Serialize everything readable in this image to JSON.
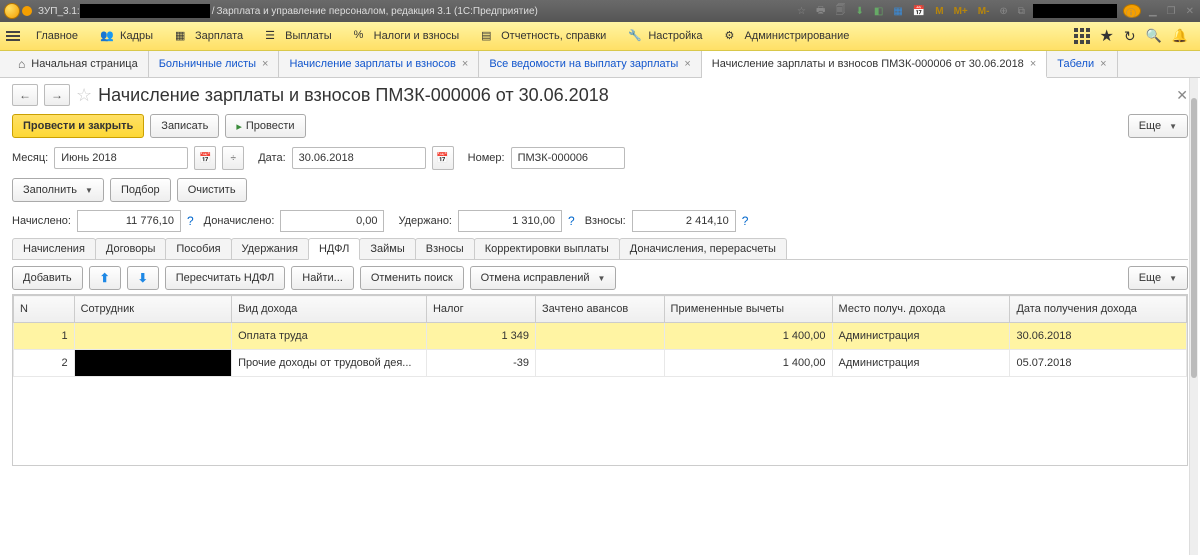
{
  "title": {
    "app_prefix": "ЗУП_3.1:",
    "app_suffix": "Зарплата и управление персоналом, редакция 3.1  (1С:Предприятие)"
  },
  "title_tray": [
    "M",
    "M+",
    "M-"
  ],
  "menu": {
    "items": [
      "Главное",
      "Кадры",
      "Зарплата",
      "Выплаты",
      "Налоги и взносы",
      "Отчетность, справки",
      "Настройка",
      "Администрирование"
    ]
  },
  "tabs": [
    {
      "label": "Начальная страница",
      "home": true
    },
    {
      "label": "Больничные листы"
    },
    {
      "label": "Начисление зарплаты и взносов"
    },
    {
      "label": "Все ведомости на выплату зарплаты"
    },
    {
      "label": "Начисление зарплаты и взносов ПМЗК-000006 от 30.06.2018",
      "active": true
    },
    {
      "label": "Табели"
    }
  ],
  "page_title": "Начисление зарплаты и взносов ПМЗК-000006 от 30.06.2018",
  "actions": {
    "post_close": "Провести и закрыть",
    "save": "Записать",
    "post": "Провести",
    "more": "Еще"
  },
  "fields": {
    "month_label": "Месяц:",
    "month": "Июнь 2018",
    "date_label": "Дата:",
    "date": "30.06.2018",
    "number_label": "Номер:",
    "number": "ПМЗК-000006",
    "fill": "Заполнить",
    "select": "Подбор",
    "clear": "Очистить"
  },
  "sums": {
    "accrued_label": "Начислено:",
    "accrued": "11 776,10",
    "additional_label": "Доначислено:",
    "additional": "0,00",
    "withheld_label": "Удержано:",
    "withheld": "1 310,00",
    "contrib_label": "Взносы:",
    "contrib": "2 414,10"
  },
  "subtabs": [
    "Начисления",
    "Договоры",
    "Пособия",
    "Удержания",
    "НДФЛ",
    "Займы",
    "Взносы",
    "Корректировки выплаты",
    "Доначисления, перерасчеты"
  ],
  "subtab_active": 4,
  "tbl_buttons": {
    "add": "Добавить",
    "recalc": "Пересчитать НДФЛ",
    "find": "Найти...",
    "cancel_search": "Отменить поиск",
    "cancel_fix": "Отмена исправлений",
    "more": "Еще"
  },
  "columns": [
    "N",
    "Сотрудник",
    "Вид дохода",
    "Налог",
    "Зачтено авансов",
    "Примененные вычеты",
    "Место получ. дохода",
    "Дата получения дохода"
  ],
  "rows": [
    {
      "n": "1",
      "emp": "",
      "kind": "Оплата труда",
      "tax": "1 349",
      "advance": "",
      "deduct": "1 400,00",
      "place": "Администрация",
      "date": "30.06.2018",
      "sel": true
    },
    {
      "n": "2",
      "emp": "",
      "kind": "Прочие доходы от трудовой дея...",
      "tax": "-39",
      "advance": "",
      "deduct": "1 400,00",
      "place": "Администрация",
      "date": "05.07.2018"
    }
  ]
}
